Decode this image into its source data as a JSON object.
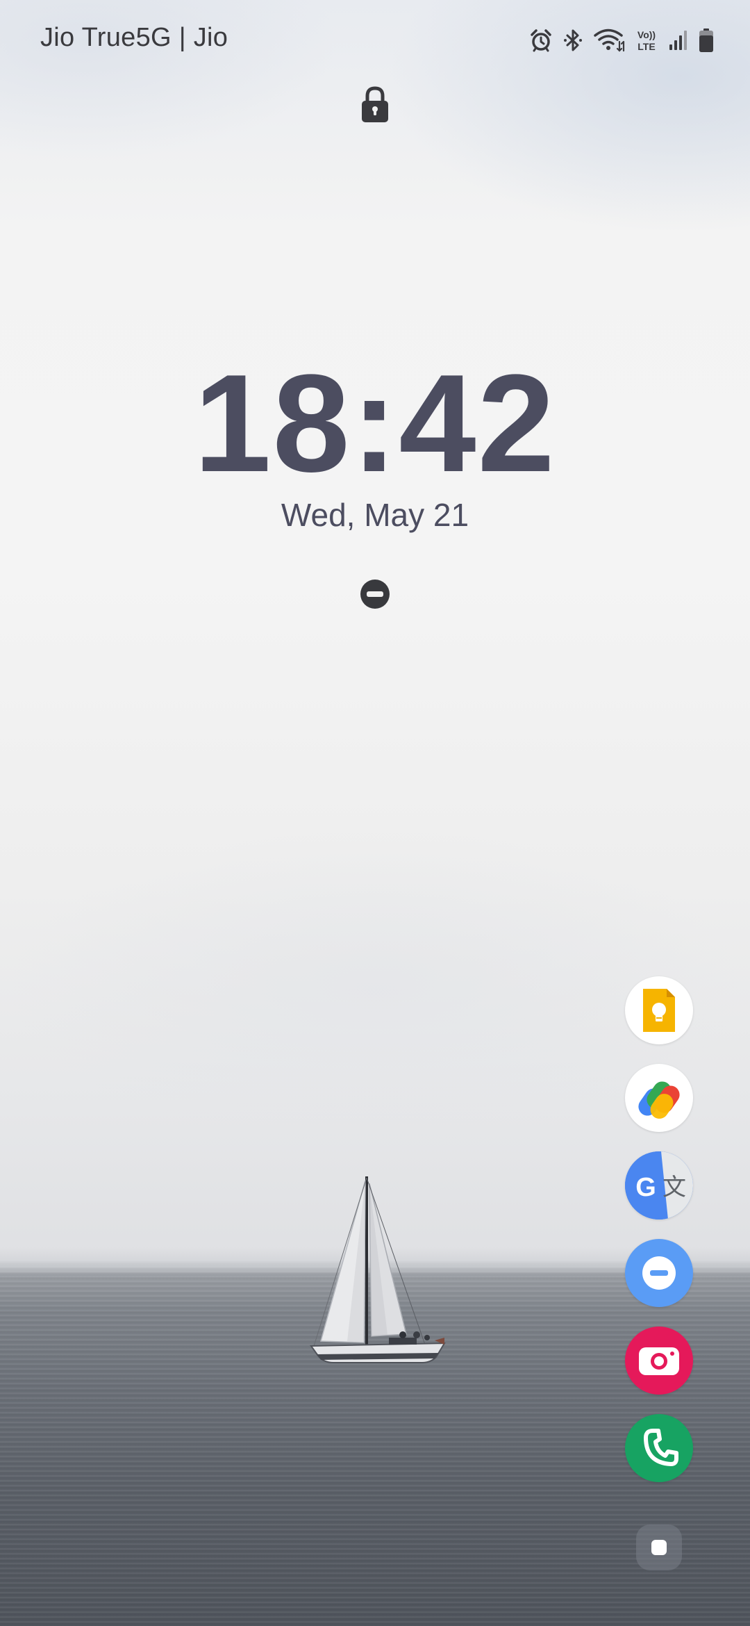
{
  "status_bar": {
    "carrier": "Jio True5G | Jio",
    "icons": [
      "alarm-icon",
      "bluetooth-icon",
      "wifi-icon",
      "volte-icon",
      "signal-icon",
      "battery-icon"
    ],
    "volte_line1": "Vo))",
    "volte_line2": "LTE"
  },
  "lock_screen": {
    "lock_icon": "lock-icon",
    "time": "18:42",
    "date": "Wed, May 21",
    "dnd_icon": "do-not-disturb-icon",
    "text_color": "#4c4d60"
  },
  "app_shortcuts": [
    {
      "name": "keep-notes",
      "icon": "keep-notes-icon",
      "accent": "#f6b400"
    },
    {
      "name": "google-pay",
      "icon": "google-pay-icon",
      "accent": "#4285f4"
    },
    {
      "name": "google-translate",
      "icon": "translate-icon",
      "accent": "#4a86f0"
    },
    {
      "name": "do-not-disturb",
      "icon": "do-not-disturb-icon",
      "accent": "#5a9cf5"
    },
    {
      "name": "camera",
      "icon": "camera-icon",
      "accent": "#e5195a"
    },
    {
      "name": "phone",
      "icon": "phone-icon",
      "accent": "#17a362"
    }
  ],
  "edge_panel_handle": "edge-panel-handle-icon",
  "translate_glyphs": {
    "g": "G",
    "wen": "文"
  }
}
